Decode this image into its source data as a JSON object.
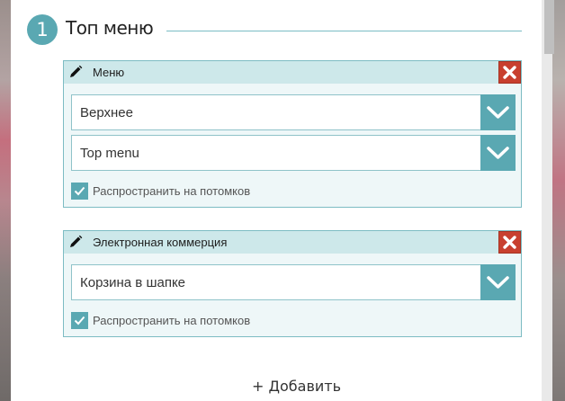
{
  "section": {
    "number": "1",
    "title": "Топ меню"
  },
  "cards": [
    {
      "title": "Меню",
      "selects": [
        "Верхнее",
        "Top menu"
      ],
      "checkbox_label": "Распространить на потомков",
      "checkbox_checked": true
    },
    {
      "title": "Электронная коммерция",
      "selects": [
        "Корзина в шапке"
      ],
      "checkbox_label": "Распространить на потомков",
      "checkbox_checked": true
    }
  ],
  "add_label": "+ Добавить",
  "colors": {
    "accent": "#5aa8b2",
    "header_bg": "#cde8ea",
    "card_bg": "#eef7f8",
    "delete": "#c8402f"
  },
  "icons": {
    "edit": "pencil-icon",
    "delete": "close-icon",
    "dropdown": "chevron-down-icon",
    "checkbox": "check-icon"
  }
}
